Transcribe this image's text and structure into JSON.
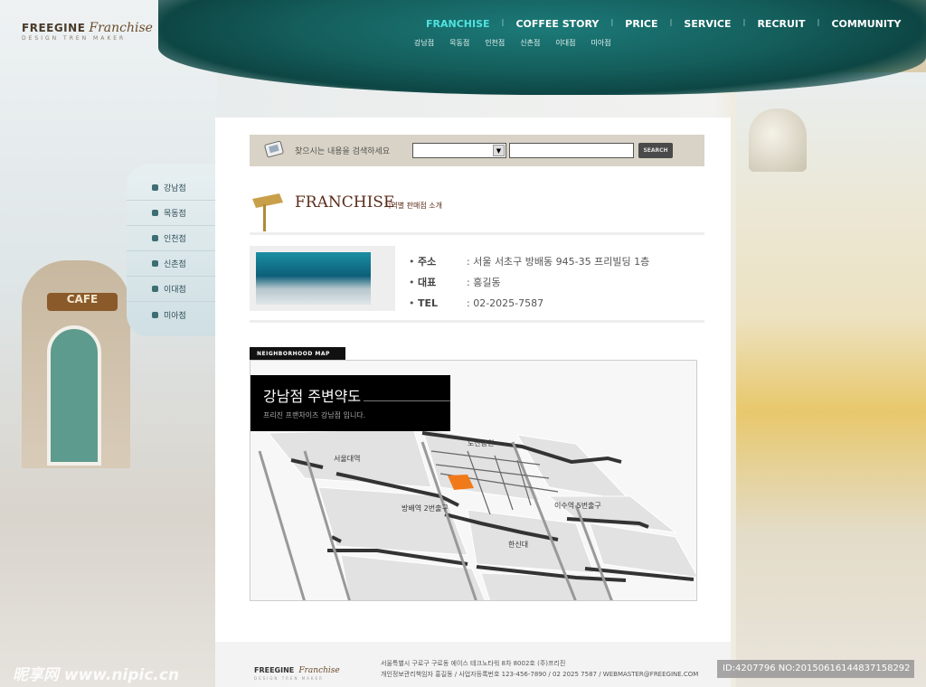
{
  "brand": {
    "name": "FREEGINE",
    "script": "Franchise",
    "tagline": "DESIGN TREN MAKER"
  },
  "nav": {
    "items": [
      {
        "label": "FRANCHISE",
        "active": true
      },
      {
        "label": "COFFEE STORY"
      },
      {
        "label": "PRICE"
      },
      {
        "label": "SERVICE"
      },
      {
        "label": "RECRUIT"
      },
      {
        "label": "COMMUNITY"
      }
    ],
    "sub": [
      "강남점",
      "목동점",
      "인천점",
      "신촌점",
      "이대점",
      "미아점"
    ]
  },
  "sidebar": {
    "items": [
      "강남점",
      "목동점",
      "인천점",
      "신촌점",
      "이대점",
      "미아점"
    ]
  },
  "search": {
    "label": "찾으시는 내용을 검색하세요",
    "select_value": "",
    "input_value": "",
    "button": "SEARCH"
  },
  "section": {
    "title": "FRANCHISE",
    "subtitle": "지역별 판매점 소개"
  },
  "store": {
    "rows": [
      {
        "key": "주소",
        "value": ": 서울 서초구 방배동 945-35 프리빌딩 1층"
      },
      {
        "key": "대표",
        "value": ": 홍길동"
      },
      {
        "key": "TEL",
        "value": ": 02-2025-7587"
      }
    ]
  },
  "map": {
    "tab": "NEIGHBORHOOD MAP",
    "title": "강남점 주변약도",
    "desc": "프리진 프랜차이즈 강남점 입니다.",
    "labels": [
      "도산공원",
      "서울대역",
      "방배역 2번출구",
      "이수역 5번출구",
      "한신대"
    ],
    "highlight_color": "#f07a1a"
  },
  "footer": {
    "brand": "FREEGINE",
    "script": "Franchise",
    "tagline": "DESIGN TREN MAKER",
    "line1": "서울특별시 구로구 구로동 에이스 테크노타워 8차 8002호 (주)프리진",
    "line2": "개인정보관리책임자 홍길동 / 사업자등록번호 123-456-7890 / 02 2025 7587 / WEBMASTER@FREEGINE.COM"
  },
  "watermark": {
    "site": "昵享网 www.nipic.cn",
    "id": "ID:4207796 NO:20150616144837158292"
  },
  "illustration": {
    "cafe_sign": "CAFE"
  }
}
